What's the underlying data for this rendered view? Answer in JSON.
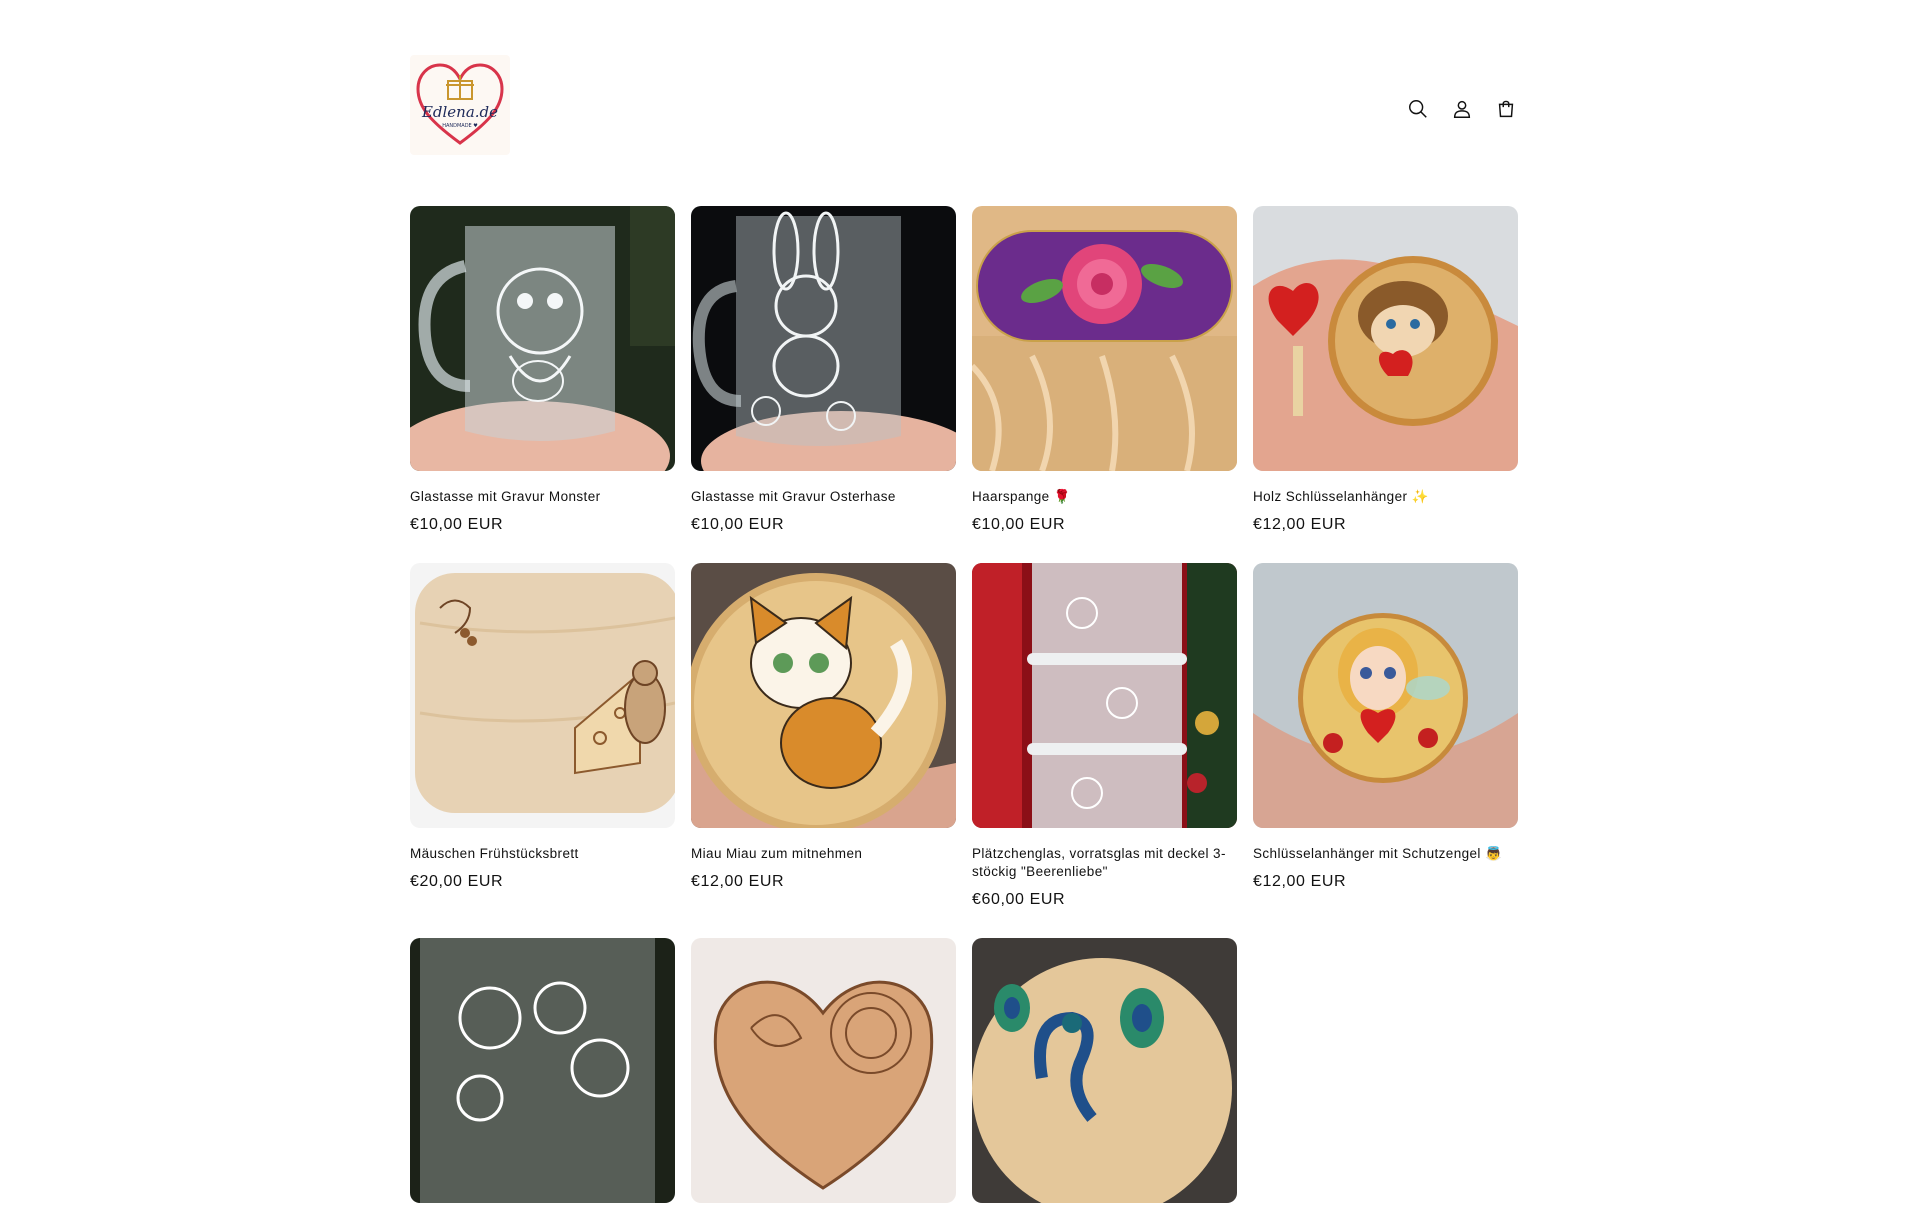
{
  "brand": {
    "logo_text": "Edlena.de",
    "logo_subtext": "HANDMADE ♥"
  },
  "header": {
    "icons": [
      "search-icon",
      "account-icon",
      "cart-icon"
    ]
  },
  "products": [
    {
      "title": "Glastasse mit Gravur Monster",
      "price": "€10,00 EUR"
    },
    {
      "title": "Glastasse mit Gravur Osterhase",
      "price": "€10,00 EUR"
    },
    {
      "title": "Haarspange 🌹",
      "price": "€10,00 EUR"
    },
    {
      "title": "Holz Schlüsselanhänger ✨",
      "price": "€12,00 EUR"
    },
    {
      "title": "Mäuschen Frühstücksbrett",
      "price": "€20,00 EUR"
    },
    {
      "title": "Miau Miau zum mitnehmen",
      "price": "€12,00 EUR"
    },
    {
      "title": "Plätzchenglas, vorratsglas mit deckel 3-stöckig \"Beerenliebe\"",
      "price": "€60,00 EUR"
    },
    {
      "title": "Schlüsselanhänger mit Schutzengel 👼",
      "price": "€12,00 EUR"
    },
    {
      "title": "",
      "price": ""
    },
    {
      "title": "",
      "price": ""
    },
    {
      "title": "",
      "price": ""
    }
  ],
  "colors": {
    "text": "#121212",
    "background": "#ffffff",
    "logo_heart": "#d8344a"
  }
}
